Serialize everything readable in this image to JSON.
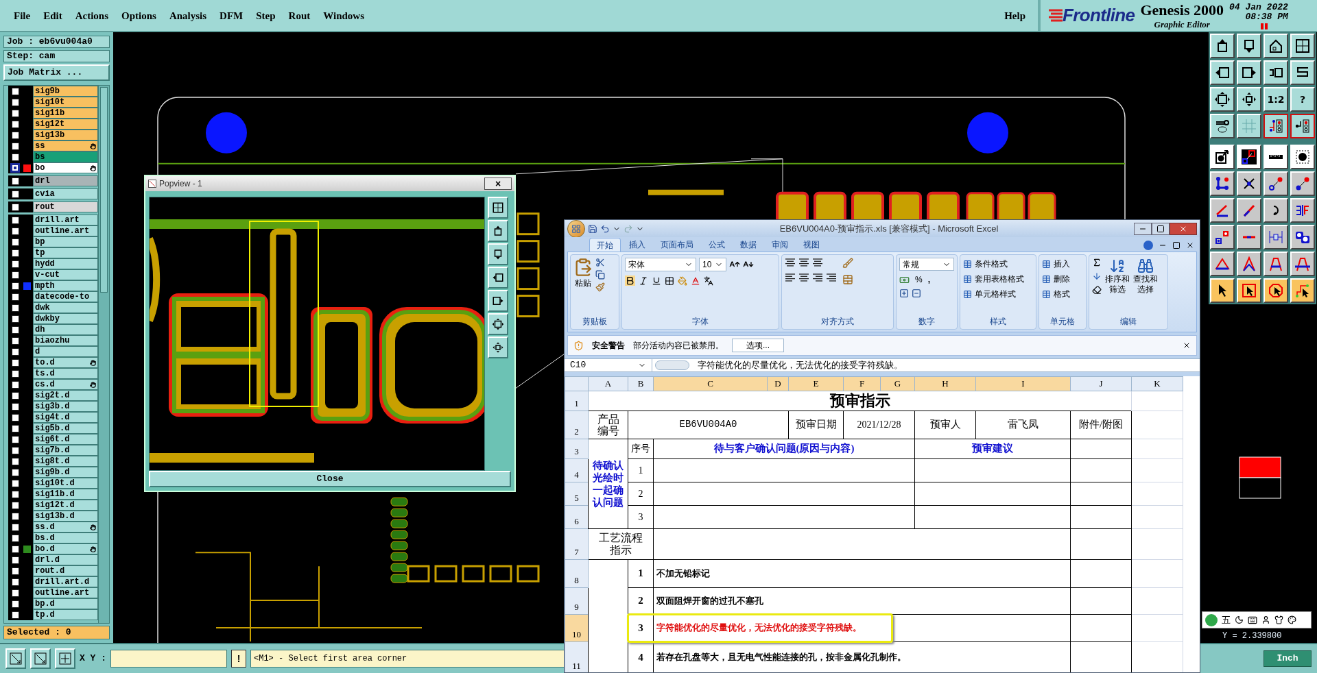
{
  "menu": {
    "items": [
      "File",
      "Edit",
      "Actions",
      "Options",
      "Analysis",
      "DFM",
      "Step",
      "Rout",
      "Windows"
    ],
    "help": "Help"
  },
  "brand": {
    "logo": "Frontline",
    "product": "Genesis 2000",
    "subtitle": "Graphic Editor",
    "date": "04 Jan 2022",
    "time": "08:38 PM"
  },
  "job": {
    "job": "Job : eb6vu004a0",
    "step": "Step: cam",
    "matrix_button": "Job Matrix ...",
    "selected_count": "Selected : 0"
  },
  "layer_groups": [
    [
      {
        "name": "sig9b",
        "kind": "signal",
        "selected": false,
        "affected": false
      },
      {
        "name": "sig10t",
        "kind": "signal",
        "selected": false,
        "affected": false
      },
      {
        "name": "sig11b",
        "kind": "signal",
        "selected": false,
        "affected": false
      },
      {
        "name": "sig12t",
        "kind": "signal",
        "selected": false,
        "affected": false
      },
      {
        "name": "sig13b",
        "kind": "signal",
        "selected": false,
        "affected": false
      },
      {
        "name": "ss",
        "kind": "signal",
        "selected": false,
        "affected": true
      },
      {
        "name": "bs",
        "kind": "mask",
        "selected": false,
        "affected": false
      },
      {
        "name": "bo",
        "kind": "silk",
        "color": "#ff1010",
        "selected": true,
        "affected": true
      }
    ],
    [
      {
        "name": "drl",
        "kind": "drill",
        "selected": false,
        "affected": false
      }
    ],
    [
      {
        "name": "cvia",
        "kind": "document",
        "selected": false,
        "affected": false
      }
    ],
    [
      {
        "name": "rout",
        "kind": "rout",
        "selected": false,
        "affected": false
      }
    ],
    [
      {
        "name": "drill.art",
        "kind": "document",
        "selected": false,
        "affected": false
      },
      {
        "name": "outline.art",
        "kind": "document",
        "selected": false,
        "affected": false
      },
      {
        "name": "bp",
        "kind": "document",
        "selected": false,
        "affected": false
      },
      {
        "name": "tp",
        "kind": "document",
        "selected": false,
        "affected": false
      },
      {
        "name": "hydd",
        "kind": "document",
        "selected": false,
        "affected": false
      },
      {
        "name": "v-cut",
        "kind": "document",
        "selected": false,
        "affected": false
      },
      {
        "name": "mpth",
        "kind": "document",
        "color": "#1030ff",
        "selected": false,
        "affected": false
      },
      {
        "name": "datecode-to",
        "kind": "document",
        "selected": false,
        "affected": false
      },
      {
        "name": "dwk",
        "kind": "document",
        "selected": false,
        "affected": false
      },
      {
        "name": "dwkby",
        "kind": "document",
        "selected": false,
        "affected": false
      },
      {
        "name": "dh",
        "kind": "document",
        "selected": false,
        "affected": false
      },
      {
        "name": "biaozhu",
        "kind": "document",
        "selected": false,
        "affected": false
      },
      {
        "name": "d",
        "kind": "document",
        "selected": false,
        "affected": false
      },
      {
        "name": "to.d",
        "kind": "document",
        "selected": false,
        "affected": true
      },
      {
        "name": "ts.d",
        "kind": "document",
        "selected": false,
        "affected": false
      },
      {
        "name": "cs.d",
        "kind": "document",
        "selected": false,
        "affected": true
      },
      {
        "name": "sig2t.d",
        "kind": "document",
        "selected": false,
        "affected": false
      },
      {
        "name": "sig3b.d",
        "kind": "document",
        "selected": false,
        "affected": false
      },
      {
        "name": "sig4t.d",
        "kind": "document",
        "selected": false,
        "affected": false
      },
      {
        "name": "sig5b.d",
        "kind": "document",
        "selected": false,
        "affected": false
      },
      {
        "name": "sig6t.d",
        "kind": "document",
        "selected": false,
        "affected": false
      },
      {
        "name": "sig7b.d",
        "kind": "document",
        "selected": false,
        "affected": false
      },
      {
        "name": "sig8t.d",
        "kind": "document",
        "selected": false,
        "affected": false
      },
      {
        "name": "sig9b.d",
        "kind": "document",
        "selected": false,
        "affected": false
      },
      {
        "name": "sig10t.d",
        "kind": "document",
        "selected": false,
        "affected": false
      },
      {
        "name": "sig11b.d",
        "kind": "document",
        "selected": false,
        "affected": false
      },
      {
        "name": "sig12t.d",
        "kind": "document",
        "selected": false,
        "affected": false
      },
      {
        "name": "sig13b.d",
        "kind": "document",
        "selected": false,
        "affected": false
      },
      {
        "name": "ss.d",
        "kind": "document",
        "selected": false,
        "affected": true
      },
      {
        "name": "bs.d",
        "kind": "document",
        "selected": false,
        "affected": false
      },
      {
        "name": "bo.d",
        "kind": "document",
        "color": "#2e8b1e",
        "selected": false,
        "affected": true
      },
      {
        "name": "drl.d",
        "kind": "document",
        "selected": false,
        "affected": false
      },
      {
        "name": "rout.d",
        "kind": "document",
        "selected": false,
        "affected": false
      },
      {
        "name": "drill.art.d",
        "kind": "document",
        "selected": false,
        "affected": false
      },
      {
        "name": "outline.art",
        "kind": "document",
        "selected": false,
        "affected": false
      },
      {
        "name": "bp.d",
        "kind": "document",
        "selected": false,
        "affected": false
      },
      {
        "name": "tp.d",
        "kind": "document",
        "selected": false,
        "affected": false
      }
    ]
  ],
  "tool_rows": [
    {
      "kind": "view",
      "buttons": [
        {
          "selected": false
        },
        {
          "selected": false
        },
        {
          "selected": false
        },
        {
          "selected": false
        }
      ]
    },
    {
      "kind": "view",
      "buttons": [
        {
          "selected": false
        },
        {
          "selected": false
        },
        {
          "selected": false
        },
        {
          "selected": false
        }
      ]
    },
    {
      "kind": "view",
      "buttons": [
        {
          "selected": false
        },
        {
          "selected": false
        },
        {
          "label": "1:2",
          "selected": false
        },
        {
          "label": "?",
          "selected": false
        }
      ]
    },
    {
      "kind": "view",
      "buttons": [
        {
          "selected": false
        },
        {
          "selected": false
        },
        {
          "selected": true
        },
        {
          "selected": true
        }
      ]
    },
    {
      "kind": "display",
      "buttons": [
        {
          "selected": false
        },
        {
          "selected": false
        },
        {
          "selected": false
        },
        {
          "selected": false
        }
      ]
    },
    {
      "kind": "edit",
      "buttons": [
        {
          "selected": false
        },
        {
          "selected": false
        },
        {
          "selected": false
        },
        {
          "selected": false
        }
      ]
    },
    {
      "kind": "edit",
      "buttons": [
        {
          "selected": false
        },
        {
          "selected": false
        },
        {
          "selected": false
        },
        {
          "selected": false
        }
      ]
    },
    {
      "kind": "edit",
      "buttons": [
        {
          "selected": false
        },
        {
          "selected": false
        },
        {
          "selected": false
        },
        {
          "selected": false
        }
      ]
    },
    {
      "kind": "edit",
      "buttons": [
        {
          "selected": false
        },
        {
          "selected": false
        },
        {
          "selected": false
        },
        {
          "selected": false
        }
      ]
    },
    {
      "kind": "select",
      "buttons": [
        {
          "selected": false
        },
        {
          "selected": false
        },
        {
          "selected": false
        },
        {
          "selected": false
        }
      ]
    }
  ],
  "coordinates": {
    "label": "X Y :",
    "confirm": "!",
    "message": "<M1> - Select first area corner",
    "y_reading": "Y = 2.339800",
    "units": "Inch"
  },
  "ime": {
    "mode": "五"
  },
  "popview": {
    "title": "Popview - 1",
    "close_glyph": "×",
    "close_button": "Close"
  },
  "excel": {
    "title": "EB6VU004A0-预审指示.xls [兼容模式] - Microsoft Excel",
    "tabs": [
      {
        "label": "开始",
        "selected": true
      },
      {
        "label": "插入",
        "selected": false
      },
      {
        "label": "页面布局",
        "selected": false
      },
      {
        "label": "公式",
        "selected": false
      },
      {
        "label": "数据",
        "selected": false
      },
      {
        "label": "审阅",
        "selected": false
      },
      {
        "label": "视图",
        "selected": false
      }
    ],
    "ribbon": {
      "paste": "粘贴",
      "clipboard": "剪贴板",
      "font_name": "宋体",
      "font_size": "10",
      "font": "字体",
      "alignment": "对齐方式",
      "number_format": "常规",
      "percent": "%",
      "comma": ",",
      "number": "数字",
      "style_items": [
        "条件格式",
        "套用表格格式",
        "单元格样式"
      ],
      "styles": "样式",
      "cell_items": [
        "插入",
        "删除",
        "格式"
      ],
      "cells": "单元格",
      "sort": "排序和筛选",
      "find": "查找和选择",
      "editing": "编辑"
    },
    "security": {
      "label": "安全警告",
      "message": "部分活动内容已被禁用。",
      "button": "选项..."
    },
    "formula": {
      "cell": "C10",
      "text": "字符能优化的尽量优化，无法优化的接受字符残缺。"
    },
    "columns": [
      {
        "label": "A",
        "selected": false
      },
      {
        "label": "B",
        "selected": false
      },
      {
        "label": "C",
        "selected": true
      },
      {
        "label": "D",
        "selected": true
      },
      {
        "label": "E",
        "selected": true
      },
      {
        "label": "F",
        "selected": true
      },
      {
        "label": "G",
        "selected": true
      },
      {
        "label": "H",
        "selected": true
      },
      {
        "label": "I",
        "selected": true
      },
      {
        "label": "J",
        "selected": false
      },
      {
        "label": "K",
        "selected": false
      }
    ],
    "rows": [
      {
        "label": "1",
        "selected": false
      },
      {
        "label": "2",
        "selected": false
      },
      {
        "label": "3",
        "selected": false
      },
      {
        "label": "4",
        "selected": false
      },
      {
        "label": "5",
        "selected": false
      },
      {
        "label": "6",
        "selected": false
      },
      {
        "label": "7",
        "selected": false
      },
      {
        "label": "8",
        "selected": false
      },
      {
        "label": "9",
        "selected": false
      },
      {
        "label": "10",
        "selected": true
      },
      {
        "label": "11",
        "selected": false
      }
    ],
    "sheet": {
      "title": "预审指示",
      "product_label": "产品编号",
      "product": "EB6VU004A0",
      "date_label": "预审日期",
      "date": "2021/12/28",
      "reviewer_label": "预审人",
      "reviewer": "雷飞凤",
      "attachment_label": "附件/附图",
      "confirm_label": "待确认光绘时一起确认问题",
      "seq_label": "序号",
      "issue_label": "待与客户确认问题(原因与内容)",
      "suggestion_label": "预审建议",
      "confirm_rows": [
        "1",
        "2",
        "3"
      ],
      "process_label": "工艺流程指示",
      "process_rows": [
        {
          "no": "1",
          "text": "不加无铅标记",
          "highlighted": false
        },
        {
          "no": "2",
          "text": "双面阻焊开窗的过孔不塞孔",
          "highlighted": false
        },
        {
          "no": "3",
          "text": "字符能优化的尽量优化，无法优化的接受字符残缺。",
          "highlighted": true
        },
        {
          "no": "4",
          "text": "若存在孔盘等大，且无电气性能连接的孔，按非金属化孔制作。",
          "highlighted": false
        }
      ]
    }
  }
}
